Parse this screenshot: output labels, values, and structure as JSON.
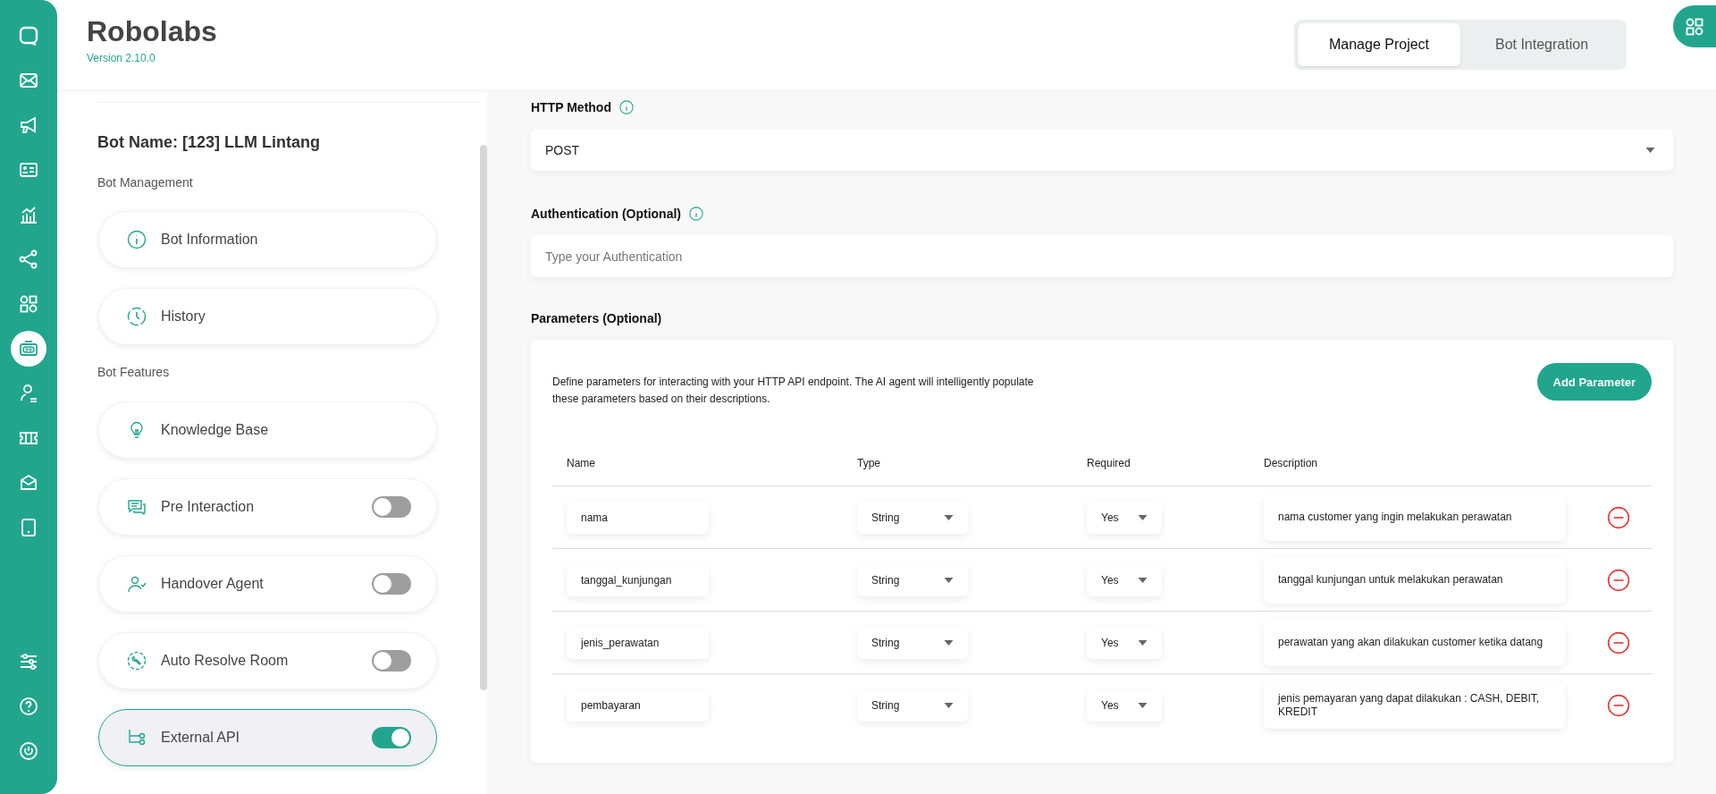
{
  "rail": [
    {
      "selected": false
    },
    {
      "selected": false
    },
    {
      "selected": false
    },
    {
      "selected": false
    },
    {
      "selected": false
    },
    {
      "selected": false
    },
    {
      "selected": false
    },
    {
      "selected": true
    },
    {
      "selected": false
    },
    {
      "selected": false
    },
    {
      "selected": false
    },
    {
      "selected": false
    }
  ],
  "rail_bottom": [
    {
      "selected": false
    },
    {
      "selected": false
    },
    {
      "selected": false
    }
  ],
  "header": {
    "title": "Robolabs",
    "version": "Version 2.10.0"
  },
  "tabs": [
    {
      "label": "Manage Project",
      "selected": true
    },
    {
      "label": "Bot Integration",
      "selected": false
    }
  ],
  "bot_name": "Bot Name: [123] LLM Lintang",
  "sections": [
    {
      "title": "Bot Management",
      "items": [
        {
          "label": "Bot Information",
          "kind": "link",
          "selected": false
        },
        {
          "label": "History",
          "kind": "link",
          "selected": false
        }
      ]
    },
    {
      "title": "Bot Features",
      "items": [
        {
          "label": "Knowledge Base",
          "kind": "link",
          "selected": false
        },
        {
          "label": "Pre Interaction",
          "kind": "toggle",
          "on": false,
          "selected": false
        },
        {
          "label": "Handover Agent",
          "kind": "toggle",
          "on": false,
          "selected": false
        },
        {
          "label": "Auto Resolve Room",
          "kind": "toggle",
          "on": false,
          "selected": false
        },
        {
          "label": "External API",
          "kind": "toggle",
          "on": true,
          "selected": true
        }
      ]
    }
  ],
  "http_method": {
    "label": "HTTP Method",
    "value": "POST"
  },
  "authentication": {
    "label": "Authentication (Optional)",
    "placeholder": "Type your Authentication"
  },
  "parameters": {
    "label": "Parameters (Optional)",
    "description": "Define parameters for interacting with your HTTP API endpoint. The AI agent will intelligently populate these parameters based on their descriptions.",
    "add_button": "Add Parameter",
    "columns": [
      "Name",
      "Type",
      "Required",
      "Description"
    ],
    "rows": [
      {
        "name": "nama",
        "type": "String",
        "required": "Yes",
        "description": "nama customer  yang ingin melakukan perawatan"
      },
      {
        "name": "tanggal_kunjungan",
        "type": "String",
        "required": "Yes",
        "description": "tanggal kunjungan untuk melakukan perawatan"
      },
      {
        "name": "jenis_perawatan",
        "type": "String",
        "required": "Yes",
        "description": "perawatan yang akan dilakukan customer ketika datang"
      },
      {
        "name": "pembayaran",
        "type": "String",
        "required": "Yes",
        "description": "jenis pemayaran yang dapat dilakukan : CASH, DEBIT, KREDIT"
      }
    ]
  }
}
